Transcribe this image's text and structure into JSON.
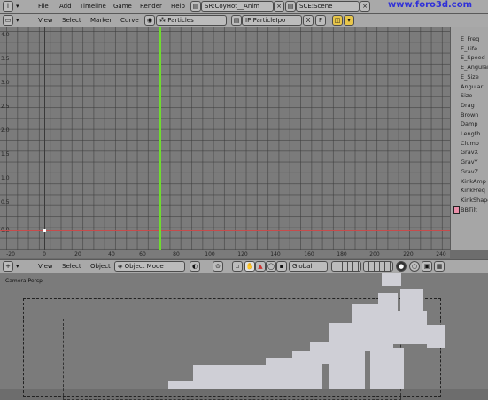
{
  "top_menu": {
    "items": [
      "File",
      "Add",
      "Timeline",
      "Game",
      "Render",
      "Help"
    ],
    "screen_select": "SR:CoyHot__Anim",
    "scene_select": "SCE:Scene",
    "watermark": "www.foro3d.com"
  },
  "ipo_header": {
    "menus": [
      "View",
      "Select",
      "Marker",
      "Curve"
    ],
    "ipo_type": "Particles",
    "ipo_block": "IP:ParticleIpo",
    "fake_user": "F",
    "delete_x": "X"
  },
  "graph": {
    "y_ticks": [
      "4.0",
      "3.5",
      "3.0",
      "2.5",
      "2.0",
      "1.5",
      "1.0",
      "0.5",
      "0.0"
    ],
    "x_ticks": [
      "-20",
      "0",
      "20",
      "40",
      "60",
      "80",
      "100",
      "120",
      "140",
      "160",
      "180",
      "200",
      "220",
      "240"
    ],
    "current_frame": 70,
    "current_frame_color": "#6fdc2e",
    "zero_line_color": "#c74b4b"
  },
  "channels": [
    "E_Freq",
    "E_Life",
    "E_Speed",
    "E_Angular",
    "E_Size",
    "Angular",
    "Size",
    "Drag",
    "Brown",
    "Damp",
    "Length",
    "Clump",
    "GravX",
    "GravY",
    "GravZ",
    "KinkAmp",
    "KinkFreq",
    "KinkShape",
    "BBTilt"
  ],
  "view3d_header": {
    "menus": [
      "View",
      "Select",
      "Object"
    ],
    "mode": "Object Mode",
    "orientation": "Global"
  },
  "viewport": {
    "label": "Camera Persp"
  }
}
